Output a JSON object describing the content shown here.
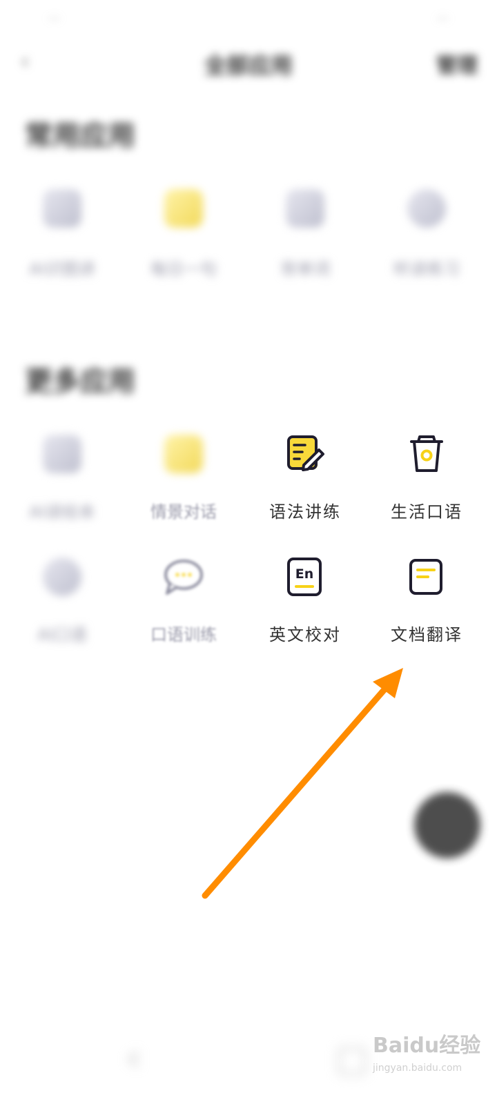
{
  "status_bar": {
    "time": "...",
    "right": "..."
  },
  "header": {
    "title": "全部应用",
    "manage": "管理"
  },
  "sections": {
    "common_title": "常用应用",
    "more_title": "更多应用"
  },
  "common_apps": [
    {
      "label": "AI识图讲",
      "icon": "app-icon"
    },
    {
      "label": "每日一句",
      "icon": "app-icon"
    },
    {
      "label": "背单词",
      "icon": "app-icon"
    },
    {
      "label": "听读练习",
      "icon": "headphones-icon"
    }
  ],
  "more_apps_row1": [
    {
      "label": "AI读绘本",
      "icon": "app-icon",
      "state": "blurred"
    },
    {
      "label": "情景对话",
      "icon": "app-icon",
      "state": "blurred"
    },
    {
      "label": "语法讲练",
      "icon": "grammar-edit-icon",
      "state": "clear"
    },
    {
      "label": "生活口语",
      "icon": "cup-icon",
      "state": "clear"
    }
  ],
  "more_apps_row2": [
    {
      "label": "AI口语",
      "icon": "app-icon",
      "state": "blurred"
    },
    {
      "label": "口语训练",
      "icon": "chat-bubble-icon",
      "state": "blurred"
    },
    {
      "label": "英文校对",
      "icon": "en-proofread-icon",
      "state": "clear"
    },
    {
      "label": "文档翻译",
      "icon": "document-translate-icon",
      "state": "clear"
    }
  ],
  "watermark": {
    "brand": "Baidu经验",
    "url": "jingyan.baidu.com"
  },
  "colors": {
    "accent_yellow": "#f7d218",
    "icon_dark": "#1f1d2e",
    "arrow_orange": "#ff8c00"
  }
}
